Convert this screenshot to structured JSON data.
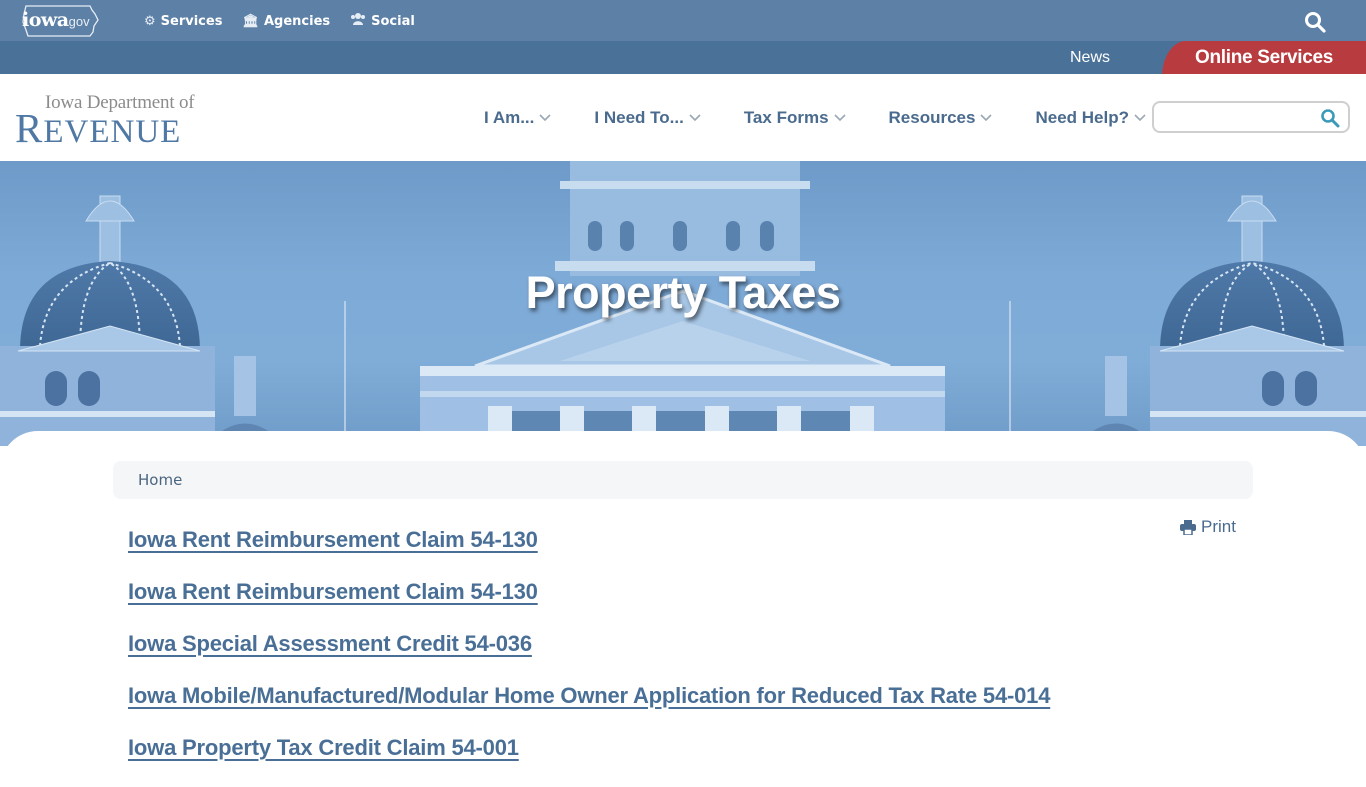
{
  "gov_bar": {
    "logo_word": "iowa",
    "logo_suffix": ".gov",
    "links": [
      {
        "label": "Services",
        "icon": "gears-icon"
      },
      {
        "label": "Agencies",
        "icon": "building-columns-icon"
      },
      {
        "label": "Social",
        "icon": "users-icon"
      }
    ],
    "search_icon": "search-icon"
  },
  "sub_bar": {
    "news_label": "News",
    "online_services_label": "Online Services"
  },
  "header": {
    "logo_top": "Iowa Department of",
    "logo_bottom_first": "R",
    "logo_bottom_rest": "EVENUE",
    "nav": [
      {
        "label": "I Am..."
      },
      {
        "label": "I Need To..."
      },
      {
        "label": "Tax Forms"
      },
      {
        "label": "Resources"
      },
      {
        "label": "Need Help?"
      }
    ],
    "search": {
      "value": "",
      "placeholder": ""
    }
  },
  "hero": {
    "title": "Property Taxes"
  },
  "breadcrumb": {
    "items": [
      "Home"
    ]
  },
  "actions": {
    "print_label": "Print"
  },
  "forms": [
    "Iowa Rent Reimbursement Claim 54-130",
    "Iowa Rent Reimbursement Claim 54-130",
    "Iowa Special Assessment Credit 54-036",
    "Iowa Mobile/Manufactured/Modular Home Owner Application for Reduced Tax Rate 54-014",
    "Iowa Property Tax Credit Claim 54-001"
  ],
  "colors": {
    "gov_bar": "#5d80a6",
    "sub_bar": "#4a7299",
    "online_services": "#b83c3f",
    "link": "#4a6f96",
    "nav_text": "#4a6b8e"
  }
}
